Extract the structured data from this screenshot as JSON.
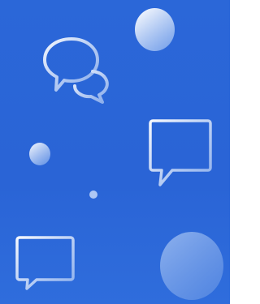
{
  "illustration": {
    "background_color": "#2b67d8",
    "highlight_color": "#e9f1ff",
    "icons": [
      "chat-bubbles-icon",
      "message-lines-icon",
      "message-line-icon"
    ],
    "decorations": [
      "circle-large-top",
      "circle-small-left",
      "circle-dot-center",
      "circle-large-bottom"
    ]
  }
}
